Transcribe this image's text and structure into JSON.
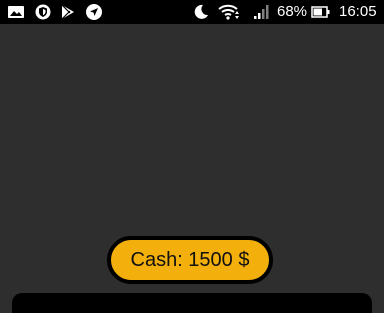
{
  "status_bar": {
    "left_icons": [
      "gallery-icon",
      "shield-icon",
      "play-store-icon",
      "navigation-icon"
    ],
    "right_icons": [
      "do-not-disturb-moon-icon",
      "wifi-icon",
      "signal-icon",
      "battery-icon"
    ],
    "battery_percent": "68%",
    "time": "16:05"
  },
  "game": {
    "cash_label": "Cash: 1500 $",
    "colors": {
      "background": "#2e2e2e",
      "cash_pill": "#f3b00c",
      "status_bar": "#000000"
    }
  }
}
